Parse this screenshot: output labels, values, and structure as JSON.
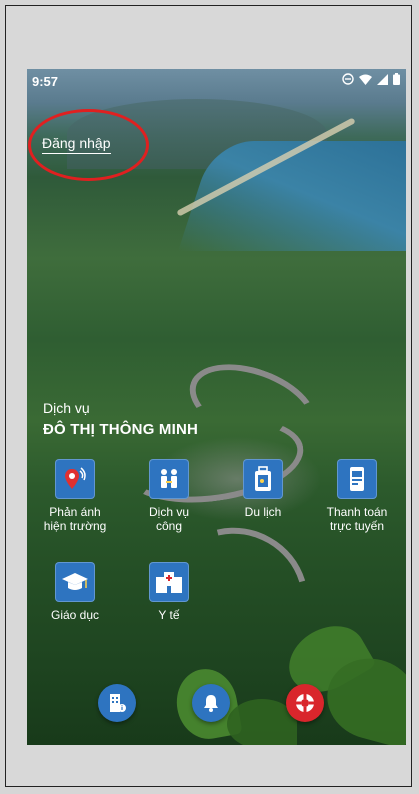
{
  "status_bar": {
    "time": "9:57"
  },
  "header": {
    "login_label": "Đăng nhập"
  },
  "hero": {
    "subtitle": "Dịch vụ",
    "title": "ĐÔ THỊ THÔNG MINH"
  },
  "services": [
    {
      "label_line1": "Phản ánh",
      "label_line2": "hiện trường",
      "icon": "location-pin-icon"
    },
    {
      "label_line1": "Dịch vụ",
      "label_line2": "công",
      "icon": "public-service-icon"
    },
    {
      "label_line1": "Du lịch",
      "label_line2": "",
      "icon": "luggage-icon"
    },
    {
      "label_line1": "Thanh toán",
      "label_line2": "trực tuyến",
      "icon": "payment-icon"
    },
    {
      "label_line1": "Giáo dục",
      "label_line2": "",
      "icon": "graduation-cap-icon"
    },
    {
      "label_line1": "Y tế",
      "label_line2": "",
      "icon": "hospital-icon"
    }
  ],
  "bottom_actions": [
    {
      "icon": "building-info-icon",
      "color": "#2e74c0"
    },
    {
      "icon": "bell-icon",
      "color": "#2e74c0"
    },
    {
      "icon": "lifebuoy-icon",
      "color": "#d9262c"
    }
  ],
  "colors": {
    "accent": "#2e74c0",
    "highlight": "#e02020",
    "sos": "#d9262c"
  }
}
